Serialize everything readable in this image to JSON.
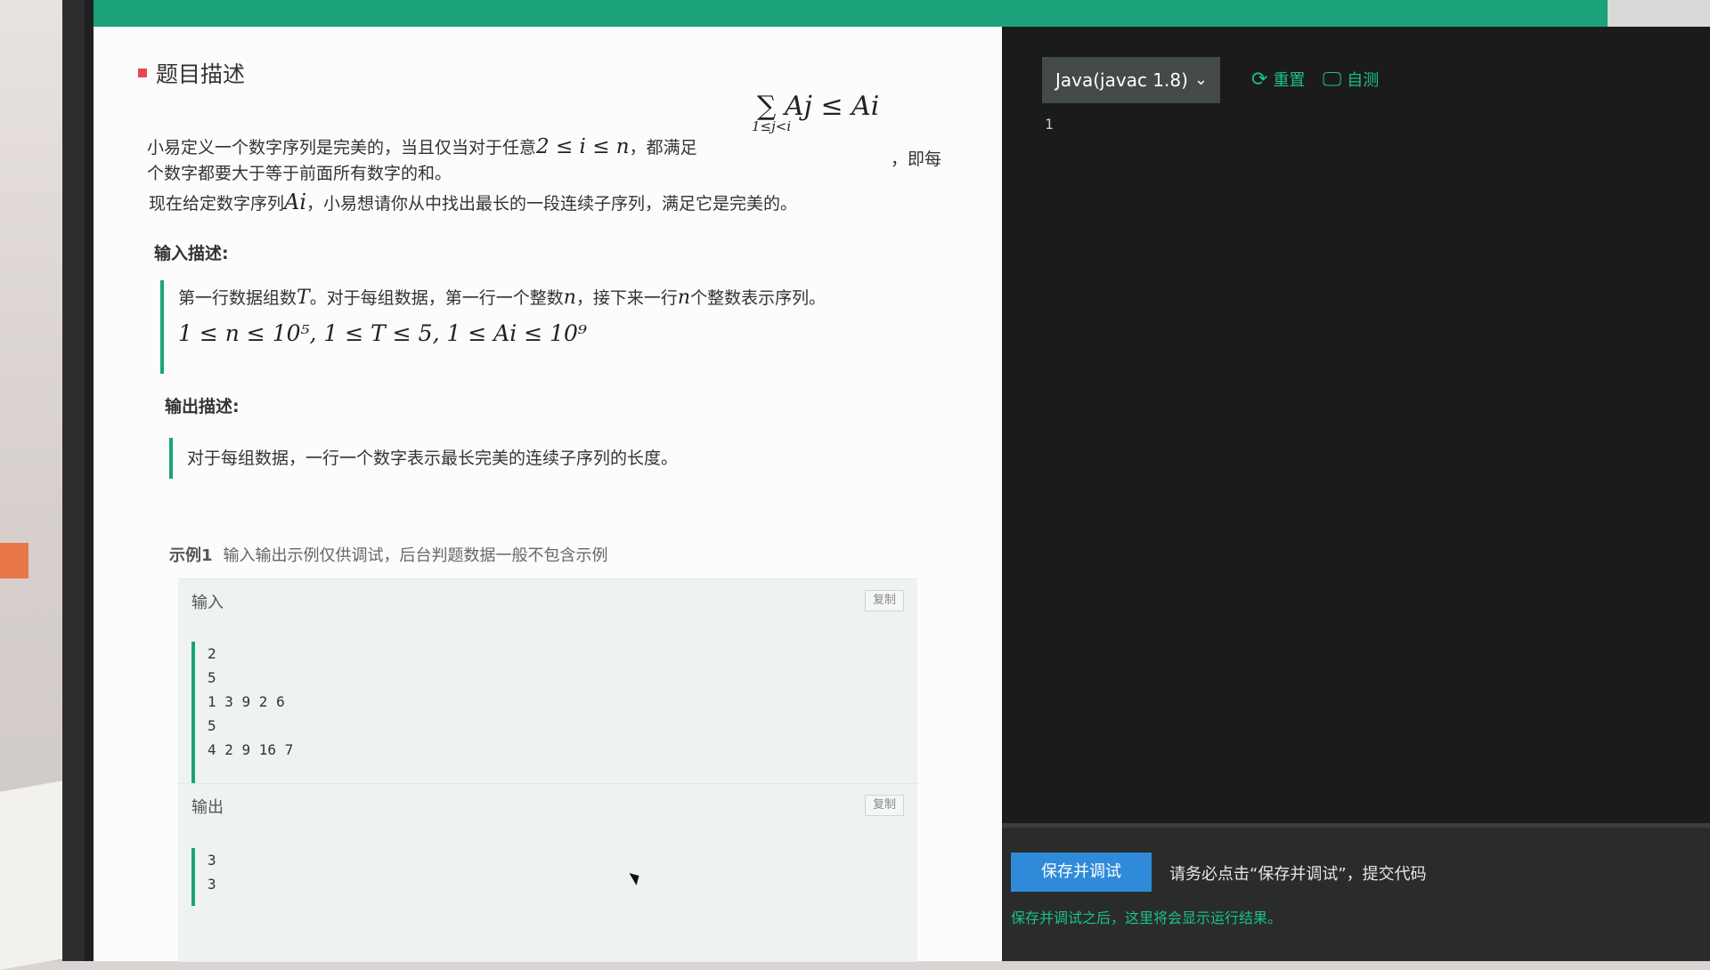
{
  "problem": {
    "section_title": "题目描述",
    "desc_line1_pre": "小易定义一个数字序列是完美的，当且仅当对于任意",
    "desc_line1_cond": "2 ≤ i ≤ n",
    "desc_line1_mid": "，都满足",
    "desc_sum_formula": "∑ Aj ≤ Ai",
    "desc_sum_sub": "1≤j<i",
    "desc_line1_post": "，即每",
    "desc_line2": "个数字都要大于等于前面所有数字的和。",
    "desc_line3_pre": "现在给定数字序列",
    "desc_line3_var": "Ai",
    "desc_line3_post": "，小易想请你从中找出最长的一段连续子序列，满足它是完美的。",
    "input_heading": "输入描述:",
    "input_text_1": "第一行数据组数",
    "input_var_T": "T",
    "input_text_2": "。对于每组数据，第一行一个整数",
    "input_var_n": "n",
    "input_text_3": "，接下来一行",
    "input_var_n2": "n",
    "input_text_4": "个整数表示序列。",
    "input_constraints": "1 ≤ n ≤ 10⁵, 1 ≤ T ≤ 5, 1 ≤ Ai ≤ 10⁹",
    "output_heading": "输出描述:",
    "output_text": "对于每组数据，一行一个数字表示最长完美的连续子序列的长度。",
    "example_label": "示例1",
    "example_note": "输入输出示例仅供调试，后台判题数据一般不包含示例",
    "input_label": "输入",
    "output_label": "输出",
    "copy_label": "复制",
    "sample_input": "2\n5\n1 3 9 2 6\n5\n4 2 9 16 7",
    "sample_output": "3\n3"
  },
  "editor": {
    "language": "Java(javac 1.8)",
    "reset_label": "重置",
    "selftest_label": "自测",
    "line_number": "1",
    "save_debug_label": "保存并调试",
    "footer_note": "请务必点击“保存并调试”，提交代码",
    "result_note": "保存并调试之后，这里将会显示运行结果。"
  },
  "colors": {
    "accent": "#1ca27a",
    "save_button": "#2f8bd9",
    "editor_bg": "#1b1c1a"
  }
}
